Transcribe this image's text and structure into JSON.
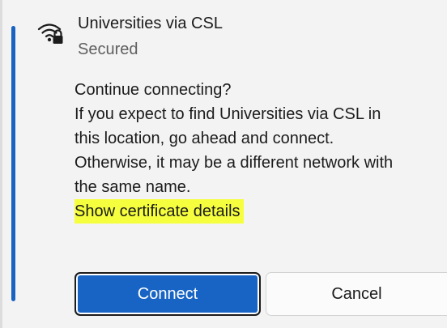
{
  "network": {
    "name": "Universities via CSL",
    "status": "Secured",
    "icon": "wifi-secured-icon"
  },
  "message": {
    "lines": [
      "Continue connecting?",
      "If you expect to find Universities via CSL in",
      "this location, go ahead and connect.",
      "Otherwise, it may be a different network with",
      "the same name."
    ],
    "link_label": "Show certificate details"
  },
  "buttons": {
    "connect_label": "Connect",
    "cancel_label": "Cancel"
  },
  "colors": {
    "accent": "#1a62c2",
    "primary_button": "#1764c4",
    "highlight": "#f6ff3d"
  }
}
